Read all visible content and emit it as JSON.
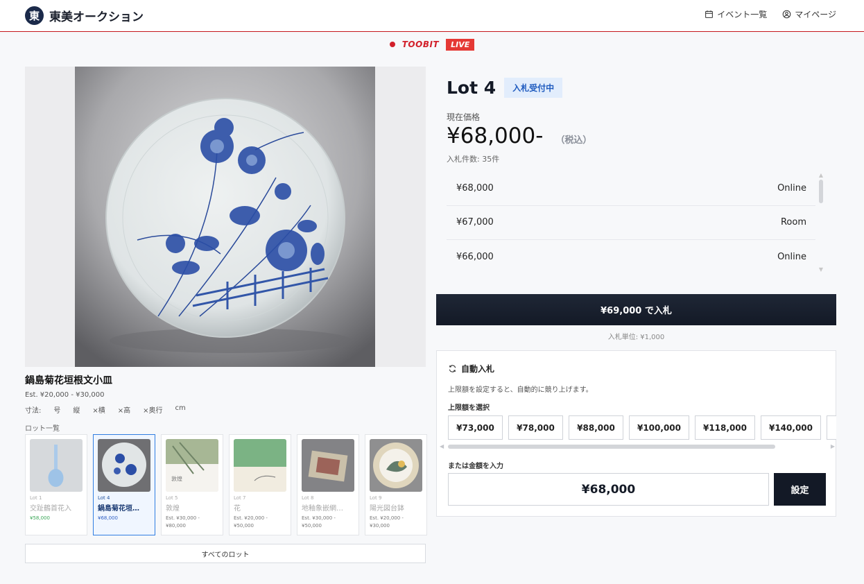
{
  "header": {
    "brand_logo_char": "東",
    "brand_name": "東美オークション",
    "nav": {
      "events_label": "イベント一覧",
      "mypage_label": "マイページ"
    }
  },
  "live": {
    "brand": "TOOBIT",
    "badge": "LIVE"
  },
  "item": {
    "title": "鍋島菊花垣根文小皿",
    "estimate": "Est. ¥20,000 - ¥30,000",
    "size_label": "寸法:",
    "size_parts": [
      "号",
      "縦",
      "×横",
      "×高",
      "×奥行",
      "cm"
    ]
  },
  "lots": {
    "label": "ロット一覧",
    "items": [
      {
        "lot": "Lot 1",
        "title": "交趾鶴首花入",
        "price": "¥58,000"
      },
      {
        "lot": "Lot 4",
        "title": "鍋島菊花垣…",
        "price": "¥68,000"
      },
      {
        "lot": "Lot 5",
        "title": "敦煌",
        "price": "Est. ¥30,000 - ¥80,000"
      },
      {
        "lot": "Lot 7",
        "title": "花",
        "price": "Est. ¥20,000 - ¥50,000"
      },
      {
        "lot": "Lot 8",
        "title": "地釉象嵌網…",
        "price": "Est. ¥30,000 - ¥50,000"
      },
      {
        "lot": "Lot 9",
        "title": "陽光図台鉢",
        "price": "Est. ¥20,000 - ¥30,000"
      }
    ],
    "all_label": "すべてのロット"
  },
  "panel": {
    "lot_title": "Lot 4",
    "status": "入札受付中",
    "current_label": "現在価格",
    "current_price": "¥68,000-",
    "tax": "（税込）",
    "bid_count": "入札件数: 35件",
    "history": [
      {
        "amount": "¥68,000",
        "source": "Online"
      },
      {
        "amount": "¥67,000",
        "source": "Room"
      },
      {
        "amount": "¥66,000",
        "source": "Online"
      }
    ],
    "bid_button": "¥69,000 で入札",
    "bid_unit": "入札単位: ¥1,000"
  },
  "auto_bid": {
    "title": "自動入札",
    "description": "上限額を設定すると、自動的に競り上げます。",
    "limit_label": "上限額を選択",
    "amounts": [
      "¥73,000",
      "¥78,000",
      "¥88,000",
      "¥100,000",
      "¥118,000",
      "¥140,000",
      ""
    ],
    "or_label": "または金額を入力",
    "input_value": "¥68,000",
    "set_label": "設定"
  },
  "colors": {
    "accent_red": "#d2202a",
    "navy": "#131926",
    "status_blue": "#1f5bbf"
  }
}
